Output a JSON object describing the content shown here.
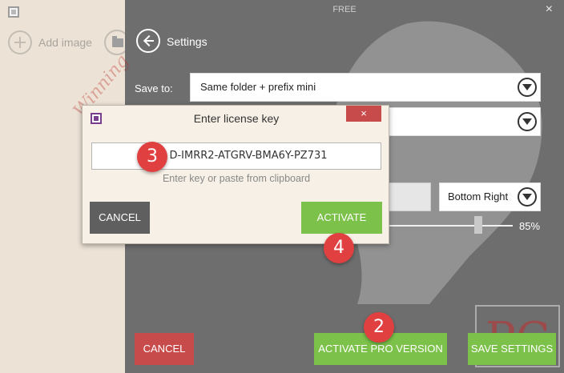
{
  "window": {
    "title": "FREE",
    "close_glyph": "×"
  },
  "left_pane": {
    "add_image_label": "Add image"
  },
  "settings": {
    "title": "Settings",
    "save_to_label": "Save to:",
    "save_to_value": "Same folder + prefix mini",
    "second_value": "",
    "position_value": "Bottom Right",
    "slider_value": "85%",
    "slider_level": 0.85
  },
  "bottom_bar": {
    "cancel": "CANCEL",
    "activate_pro": "ACTIVATE PRO VERSION",
    "save_settings": "SAVE SETTINGS"
  },
  "dialog": {
    "title": "Enter license key",
    "close_glyph": "×",
    "key_value": "D-IMRR2-ATGRV-BMA6Y-PZ731",
    "hint": "Enter key or paste from clipboard",
    "cancel": "CANCEL",
    "activate": "ACTIVATE"
  },
  "annotations": {
    "step_2": "2",
    "step_3": "3",
    "step_4": "4"
  },
  "watermark": {
    "text": "Winning",
    "logo_text": "PC"
  },
  "colors": {
    "accent_green": "#7cc14a",
    "cancel_red": "#c84b4b",
    "badge_red": "#e04040",
    "dark_bg": "#6e6e6e",
    "left_bg": "#ece3d6"
  }
}
